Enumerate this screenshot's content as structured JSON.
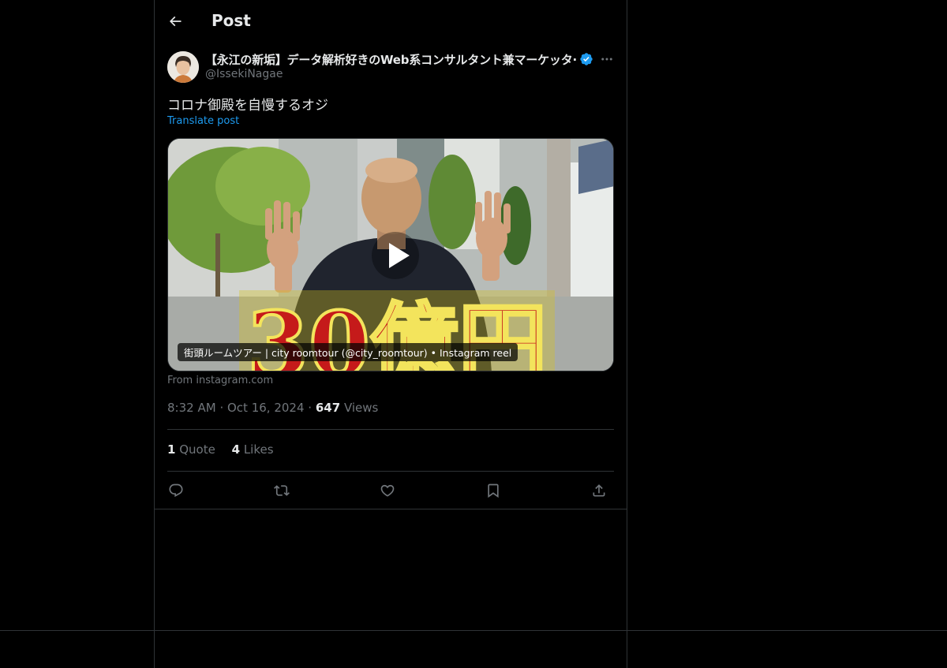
{
  "header": {
    "title": "Post",
    "back_icon": "arrow-left-icon"
  },
  "author": {
    "display_name": "【永江の新垢】データ解析好きのWeb系コンサルタント兼マーケッタ·",
    "handle": "@IssekiNagae",
    "verified_color": "#1d9bf0"
  },
  "post": {
    "text": "コロナ御殿を自慢するオジ",
    "translate_label": "Translate post",
    "media": {
      "overlay_text": "30億円",
      "caption": "街頭ルームツアー | city roomtour (@city_roomtour) • Instagram reel",
      "source": "From instagram.com"
    },
    "time": "8:32 AM",
    "date": "Oct 16, 2024",
    "views_count": "647",
    "views_label": "Views"
  },
  "stats": {
    "quotes_count": "1",
    "quotes_label": "Quote",
    "likes_count": "4",
    "likes_label": "Likes"
  },
  "actions": [
    "reply-icon",
    "repost-icon",
    "like-icon",
    "bookmark-icon",
    "share-icon"
  ],
  "colors": {
    "background": "#000000",
    "text": "#e7e9ea",
    "muted": "#71767b",
    "accent": "#1d9bf0",
    "border": "#2f3336"
  }
}
